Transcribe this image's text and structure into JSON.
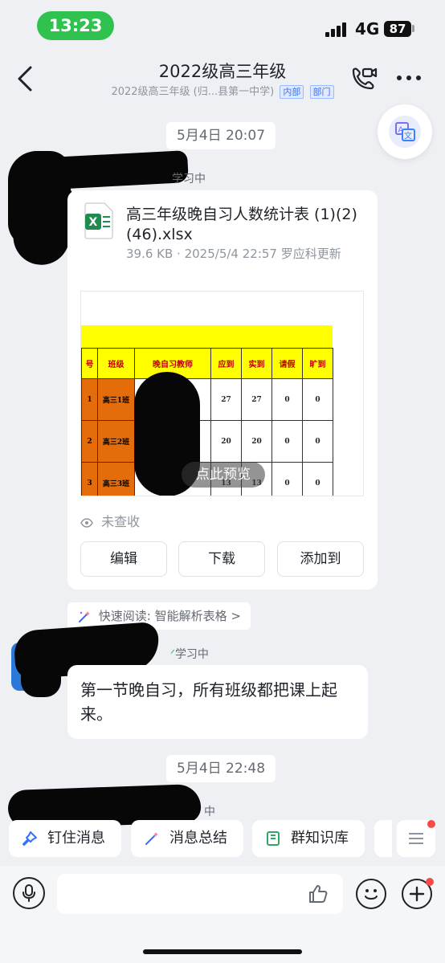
{
  "status_bar": {
    "time": "13:23",
    "network": "4G",
    "battery": "87"
  },
  "header": {
    "title": "2022级高三年级",
    "subtitle": "2022级高三年级 (归...县第一中学)",
    "tags": [
      "内部",
      "部门"
    ]
  },
  "messages": {
    "time1": "5月4日 20:07",
    "sender_status": "学习中",
    "file": {
      "name": "高三年级晚自习人数统计表 (1)(2)(46).xlsx",
      "meta": "39.6 KB · 2025/5/4 22:57 罗应科更新",
      "preview_label": "点此预览",
      "read_status": "未查收",
      "buttons": [
        "编辑",
        "下载",
        "添加到"
      ],
      "table": {
        "headers": [
          "号",
          "班级",
          "晚自习教师",
          "应到",
          "实到",
          "请假",
          "旷到"
        ],
        "rows": [
          [
            "1",
            "高三1班",
            "",
            "27",
            "27",
            "0",
            "0"
          ],
          [
            "2",
            "高三2班",
            "",
            "20",
            "20",
            "0",
            "0"
          ],
          [
            "3",
            "高三3班",
            "",
            "13",
            "13",
            "0",
            "0"
          ]
        ]
      }
    },
    "quick_read": "快速阅读: 智能解析表格 >",
    "sender_status2": "学习中",
    "text_message": "第一节晚自习，所有班级都把课上起来。",
    "time2": "5月4日 22:48",
    "sender_status3": "中"
  },
  "quick_actions": [
    "钉住消息",
    "消息总结",
    "群知识库"
  ]
}
